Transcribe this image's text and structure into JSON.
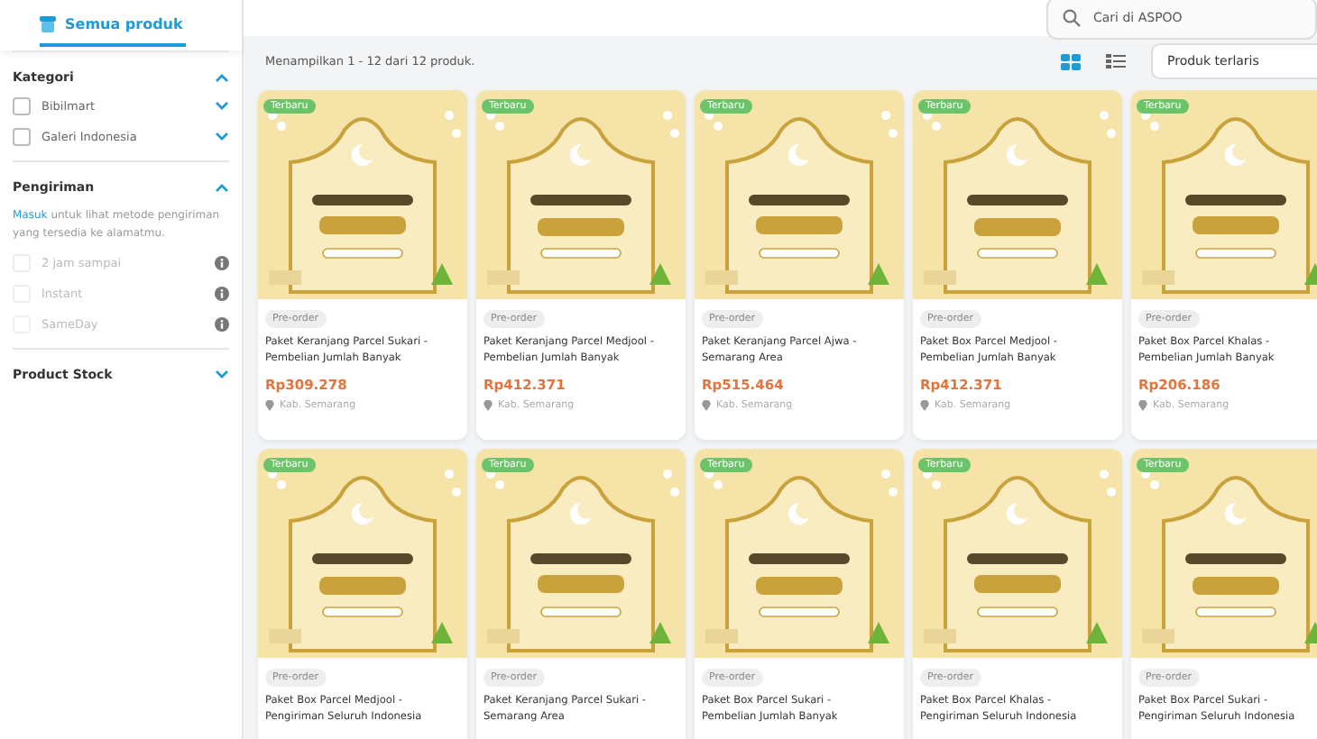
{
  "header": {
    "tab": "Semua produk",
    "search": {
      "placeholder": "Cari di ASPOO"
    }
  },
  "sidebar": {
    "sections": [
      {
        "title": "Kategori",
        "expanded": true,
        "items": [
          {
            "label": "Bibilmart",
            "checked": false,
            "disabled": false
          },
          {
            "label": "Galeri Indonesia",
            "checked": false,
            "disabled": false
          }
        ]
      },
      {
        "title": "Pengiriman",
        "expanded": true,
        "note": {
          "link": "Masuk",
          "text": "untuk lihat metode pengiriman yang tersedia ke alamatmu."
        },
        "items": [
          {
            "label": "2 jam sampai",
            "checked": false,
            "disabled": true
          },
          {
            "label": "Instant",
            "checked": false,
            "disabled": true
          },
          {
            "label": "SameDay",
            "checked": false,
            "disabled": true
          }
        ]
      },
      {
        "title": "Product Stock",
        "expanded": false
      }
    ]
  },
  "results": {
    "summary": "Menampilkan 1 - 12 dari 12 produk.",
    "views": [
      {
        "kind": "grid",
        "selected": true
      },
      {
        "kind": "list",
        "selected": false
      }
    ],
    "sort": "Produk terlaris"
  },
  "products": [
    {
      "badge": "Terbaru",
      "tag": "Pre-order",
      "name": "Paket Keranjang Parcel Sukari - Pembelian Jumlah Banyak",
      "price": "Rp309.278",
      "location": "Kab. Semarang"
    },
    {
      "badge": "Terbaru",
      "tag": "Pre-order",
      "name": "Paket Keranjang Parcel Medjool - Pembelian Jumlah Banyak",
      "price": "Rp412.371",
      "location": "Kab. Semarang"
    },
    {
      "badge": "Terbaru",
      "tag": "Pre-order",
      "name": "Paket Keranjang Parcel Ajwa - Semarang Area",
      "price": "Rp515.464",
      "location": "Kab. Semarang"
    },
    {
      "badge": "Terbaru",
      "tag": "Pre-order",
      "name": "Paket Box Parcel Medjool - Pembelian Jumlah Banyak",
      "price": "Rp412.371",
      "location": "Kab. Semarang"
    },
    {
      "badge": "Terbaru",
      "tag": "Pre-order",
      "name": "Paket Box Parcel Khalas - Pembelian Jumlah Banyak",
      "price": "Rp206.186",
      "location": "Kab. Semarang"
    },
    {
      "badge": "Terbaru",
      "tag": "Pre-order",
      "name": "Paket Box Parcel Medjool - Pengiriman Seluruh Indonesia"
    },
    {
      "badge": "Terbaru",
      "tag": "Pre-order",
      "name": "Paket Keranjang Parcel Sukari - Semarang Area"
    },
    {
      "badge": "Terbaru",
      "tag": "Pre-order",
      "name": "Paket Box Parcel Sukari - Pembelian Jumlah Banyak"
    },
    {
      "badge": "Terbaru",
      "tag": "Pre-order",
      "name": "Paket Box Parcel Khalas - Pengiriman Seluruh Indonesia"
    },
    {
      "badge": "Terbaru",
      "tag": "Pre-order",
      "name": "Paket Box Parcel Sukari - Pengiriman Seluruh Indonesia"
    }
  ]
}
